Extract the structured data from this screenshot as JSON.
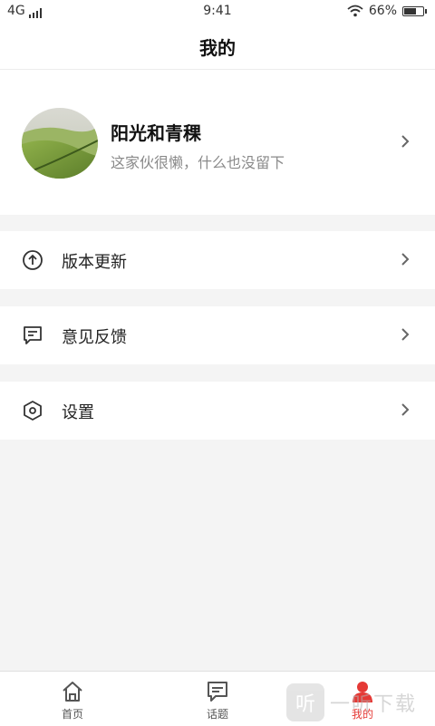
{
  "status_bar": {
    "network": "4G",
    "time": "9:41",
    "battery": "66%",
    "battery_level": 0.66,
    "icons": [
      "signal-icon",
      "wifi-icon",
      "battery-icon"
    ]
  },
  "header": {
    "title": "我的"
  },
  "profile": {
    "name": "阳光和青稞",
    "bio": "这家伙很懒，什么也没留下",
    "avatar_icon": "landscape-avatar"
  },
  "menu": [
    {
      "label": "版本更新",
      "icon": "upload-circle-icon"
    },
    {
      "label": "意见反馈",
      "icon": "feedback-icon"
    },
    {
      "label": "设置",
      "icon": "settings-hexagon-icon"
    }
  ],
  "tabs": [
    {
      "label": "首页",
      "icon": "home-icon",
      "active": false
    },
    {
      "label": "话题",
      "icon": "chat-icon",
      "active": false
    },
    {
      "label": "我的",
      "icon": "user-icon",
      "active": true
    }
  ],
  "watermark": {
    "text": "一听下载",
    "logo_glyph": "听"
  },
  "colors": {
    "accent": "#e53935",
    "background": "#f4f4f4",
    "text_secondary": "#8a8a8a"
  }
}
